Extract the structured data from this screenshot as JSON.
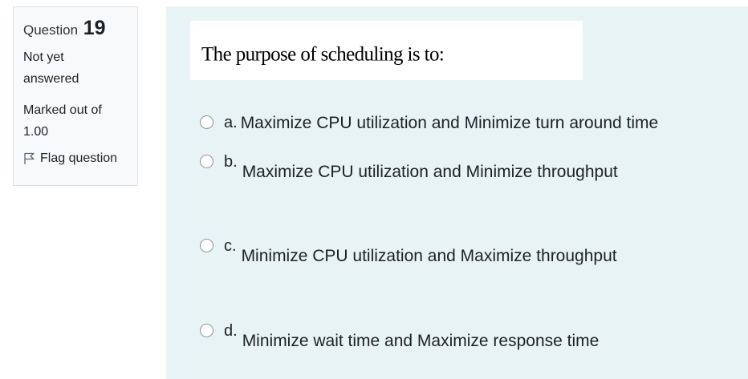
{
  "info": {
    "question_label": "Question",
    "question_number": "19",
    "state": "Not yet answered",
    "grade": "Marked out of 1.00",
    "flag_label": "Flag question"
  },
  "question": {
    "text": "The purpose of scheduling is to:",
    "options": [
      {
        "letter": "a.",
        "text": "Maximize CPU utilization and Minimize turn around time"
      },
      {
        "letter": "b.",
        "text": "Maximize CPU utilization and Minimize throughput"
      },
      {
        "letter": "c.",
        "text": "Minimize CPU utilization and Maximize throughput"
      },
      {
        "letter": "d.",
        "text": "Minimize wait time and Maximize response time"
      }
    ]
  }
}
